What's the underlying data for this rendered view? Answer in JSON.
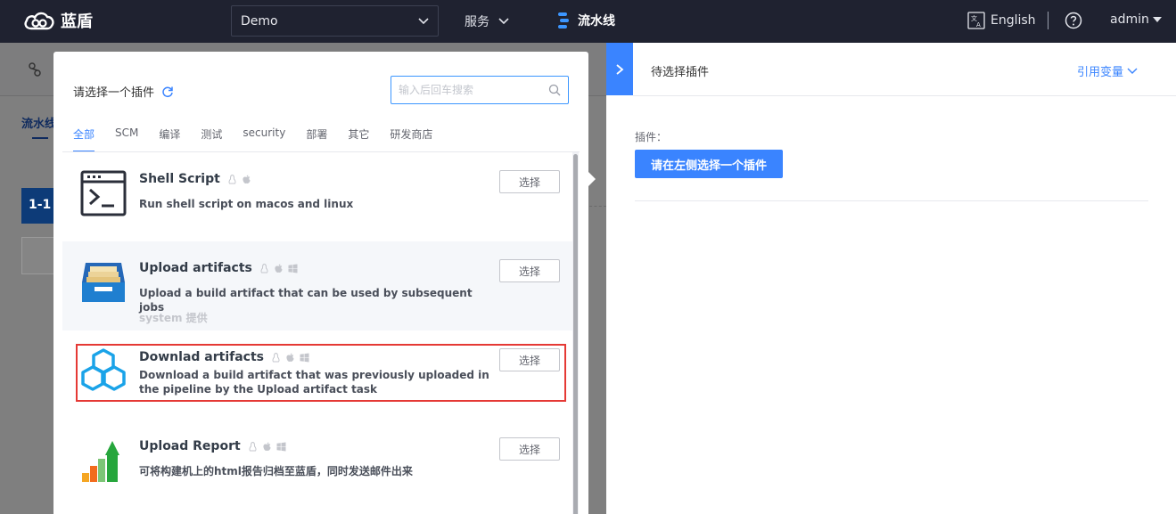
{
  "topbar": {
    "brand": "蓝盾",
    "project": "Demo",
    "service": "服务",
    "pipeline": "流水线",
    "language": "English",
    "user": "admin"
  },
  "background": {
    "tab": "流水线",
    "stage": "1-1"
  },
  "modal": {
    "title": "请选择一个插件",
    "search_placeholder": "输入后回车搜索",
    "tabs": [
      "全部",
      "SCM",
      "编译",
      "测试",
      "security",
      "部署",
      "其它",
      "研发商店"
    ],
    "active_tab": "全部",
    "select_label": "选择",
    "plugins": [
      {
        "name": "Shell Script",
        "icon": "terminal-icon",
        "os": [
          "linux-icon",
          "apple-icon"
        ],
        "description": "Run shell script on macos and linux",
        "provider": ""
      },
      {
        "name": "Upload artifacts",
        "icon": "upload-tray-icon",
        "os": [
          "linux-icon",
          "apple-icon",
          "windows-icon"
        ],
        "description": "Upload a build artifact that can be used by subsequent jobs",
        "provider": "system 提供"
      },
      {
        "name": "Downlad artifacts",
        "icon": "cubes-icon",
        "os": [
          "linux-icon",
          "apple-icon",
          "windows-icon"
        ],
        "description": "Download a build artifact that was previously uploaded in the pipeline by the Upload artifact task",
        "provider": ""
      },
      {
        "name": "Upload Report",
        "icon": "report-chart-icon",
        "os": [
          "linux-icon",
          "apple-icon",
          "windows-icon"
        ],
        "description": "可将构建机上的html报告归档至蓝盾，同时发送邮件出来",
        "provider": ""
      }
    ]
  },
  "right_panel": {
    "title": "待选择插件",
    "var_link": "引用变量",
    "plugin_label": "插件：",
    "choose_button": "请在左侧选择一个插件"
  },
  "colors": {
    "topbar": "#1f2230",
    "primary": "#3a84ff",
    "highlight": "#e53935"
  }
}
